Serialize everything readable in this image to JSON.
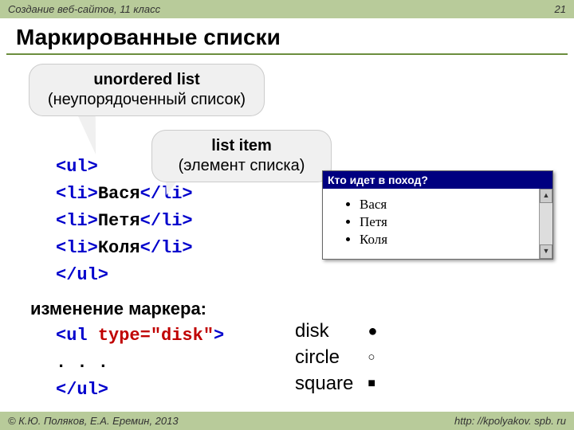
{
  "header": {
    "course": "Создание веб-сайтов, 11 класс",
    "page": "21"
  },
  "title": "Маркированные списки",
  "callout1": {
    "line1": "unordered list",
    "line2": "(неупорядоченный список)"
  },
  "callout2": {
    "line1": "list item",
    "line2": "(элемент списка)"
  },
  "code1": {
    "l1": "<ul>",
    "l2a": "<li>",
    "l2b": "Вася",
    "l2c": "</li>",
    "l3a": "<li>",
    "l3b": "Петя",
    "l3c": "</li>",
    "l4a": "<li>",
    "l4b": "Коля",
    "l4c": "</li>",
    "l5": "</ul>"
  },
  "section_label": "изменение маркера:",
  "code2": {
    "l1a": "<ul ",
    "l1b": "type=\"disk\"",
    "l1c": ">",
    "l2": ". . .",
    "l3": "</ul>"
  },
  "browser": {
    "titlebar": "Кто идет в поход?",
    "items": [
      "Вася",
      "Петя",
      "Коля"
    ]
  },
  "markers": {
    "r1": "disk",
    "g1": "●",
    "r2": "circle",
    "g2": "○",
    "r3": "square",
    "g3": "■"
  },
  "footer": {
    "copyright": "© К.Ю. Поляков, Е.А. Еремин, 2013",
    "url": "http: //kpolyakov. spb. ru"
  }
}
